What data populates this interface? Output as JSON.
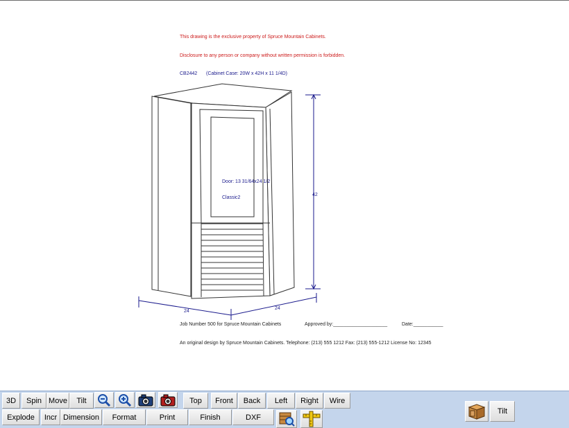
{
  "drawing": {
    "notice_line1": "This drawing is the exclusive property of Spruce Mountain Cabinets.",
    "notice_line2": "Disclosure to any person or company without written permission is forbidden.",
    "cabinet_code": "CB2442",
    "cabinet_case": "(Cabinet Case: 20W x 42H x 11 1/4D)",
    "door_label": "Door: 13 31/64x24 1/2",
    "door_style": "Classic2",
    "dim_height": "42",
    "dim_left": "24",
    "dim_right": "24",
    "job_line": "Job Number 500 for Spruce Mountain Cabinets",
    "approved_label": "Approved by:____________________",
    "date_label": "Date:___________",
    "footer_line": "An original design by Spruce Mountain Cabinets.  Telephone:  (213) 555 1212   Fax:  (213) 555-1212   License No:  12345",
    "colors": {
      "notice": "#cc1a1a",
      "dimension": "#1a1a8c",
      "toolbar": "#c4d5ec"
    }
  },
  "toolbar": {
    "row1": {
      "btn_3d": "3D",
      "btn_spin": "Spin",
      "btn_move": "Move",
      "btn_tilt": "Tilt",
      "btn_top": "Top",
      "btn_front": "Front",
      "btn_back": "Back",
      "btn_left": "Left",
      "btn_right": "Right",
      "btn_wire": "Wire"
    },
    "row2": {
      "btn_explode": "Explode",
      "btn_incr": "Incr",
      "btn_dimension": "Dimension",
      "btn_format": "Format",
      "btn_print": "Print",
      "btn_finish": "Finish",
      "btn_dxf": "DXF"
    },
    "right": {
      "btn_tilt": "Tilt"
    },
    "icons": [
      "zoom-out-icon",
      "zoom-in-icon",
      "camera-icon",
      "red-camera-icon",
      "search-cabinet-icon",
      "measure-icon",
      "cabinet-box-icon"
    ]
  }
}
